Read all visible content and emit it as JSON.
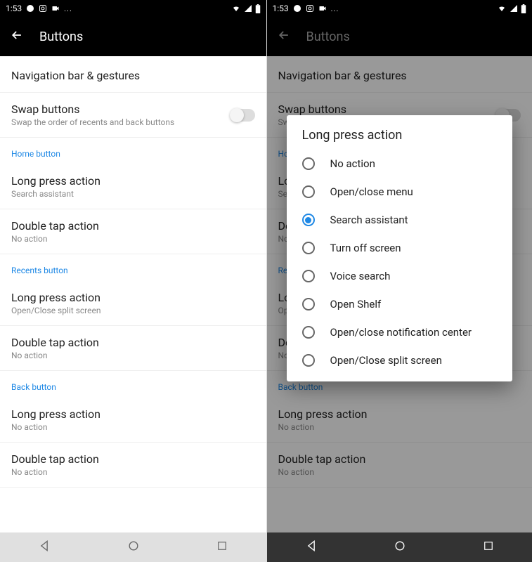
{
  "status": {
    "time": "1:53",
    "icons_left": [
      "chat-bubble-icon",
      "instagram-icon",
      "video-icon",
      "more-icon"
    ],
    "icons_right": [
      "wifi-icon",
      "signal-icon",
      "battery-icon"
    ]
  },
  "appbar": {
    "title": "Buttons"
  },
  "settings": {
    "nav_gestures": "Navigation bar & gestures",
    "swap": {
      "title": "Swap buttons",
      "sub": "Swap the order of recents and back buttons"
    },
    "sections": [
      {
        "header": "Home button",
        "items": [
          {
            "title": "Long press action",
            "sub": "Search assistant"
          },
          {
            "title": "Double tap action",
            "sub": "No action"
          }
        ]
      },
      {
        "header": "Recents button",
        "items": [
          {
            "title": "Long press action",
            "sub": "Open/Close split screen"
          },
          {
            "title": "Double tap action",
            "sub": "No action"
          }
        ]
      },
      {
        "header": "Back button",
        "items": [
          {
            "title": "Long press action",
            "sub": "No action"
          },
          {
            "title": "Double tap action",
            "sub": "No action"
          }
        ]
      }
    ]
  },
  "dialog": {
    "title": "Long press action",
    "selected_index": 2,
    "options": [
      "No action",
      "Open/close menu",
      "Search assistant",
      "Turn off screen",
      "Voice search",
      "Open Shelf",
      "Open/close notification center",
      "Open/Close split screen"
    ]
  }
}
